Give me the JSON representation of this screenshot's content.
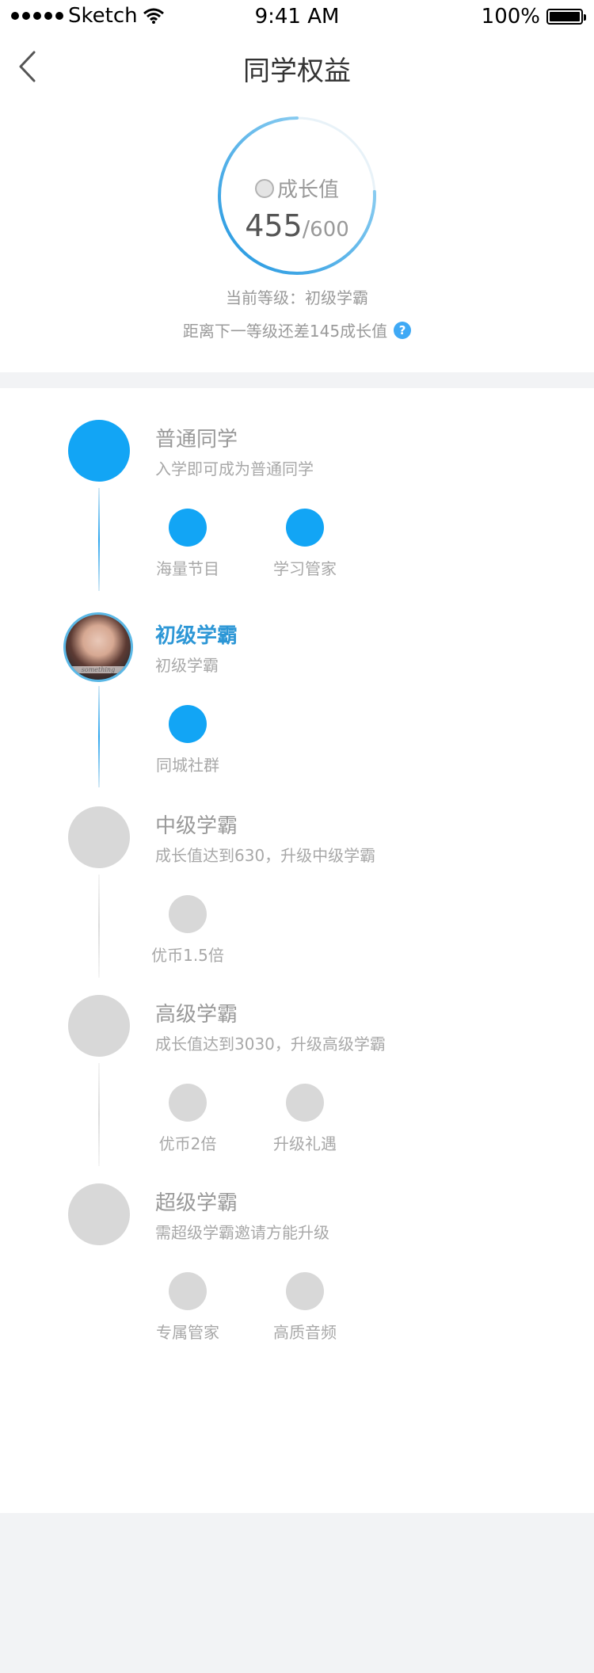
{
  "status_bar": {
    "carrier": "Sketch",
    "time": "9:41 AM",
    "battery": "100%"
  },
  "nav": {
    "title": "同学权益"
  },
  "growth": {
    "label": "成长值",
    "current": "455",
    "separator": "/",
    "max": "600",
    "progress": 0.758,
    "current_level_text": "当前等级：初级学霸",
    "next_level_text": "距离下一等级还差145成长值"
  },
  "levels": [
    {
      "title": "普通同学",
      "desc": "入学即可成为普通同学",
      "state": "unlocked",
      "benefits": [
        {
          "label": "海量节目"
        },
        {
          "label": "学习管家"
        }
      ]
    },
    {
      "title": "初级学霸",
      "desc": "初级学霸",
      "state": "current",
      "avatar_caption": "something",
      "benefits": [
        {
          "label": "同城社群"
        }
      ]
    },
    {
      "title": "中级学霸",
      "desc": "成长值达到630，升级中级学霸",
      "state": "locked",
      "benefits": [
        {
          "label": "优币1.5倍"
        }
      ]
    },
    {
      "title": "高级学霸",
      "desc": "成长值达到3030，升级高级学霸",
      "state": "locked",
      "benefits": [
        {
          "label": "优币2倍"
        },
        {
          "label": "升级礼遇"
        }
      ]
    },
    {
      "title": "超级学霸",
      "desc": "需超级学霸邀请方能升级",
      "state": "locked",
      "benefits": [
        {
          "label": "专属管家"
        },
        {
          "label": "高质音频"
        }
      ]
    }
  ],
  "colors": {
    "accent": "#12a5f5",
    "active_title": "#2d97d6",
    "locked": "#d8d8d8"
  }
}
